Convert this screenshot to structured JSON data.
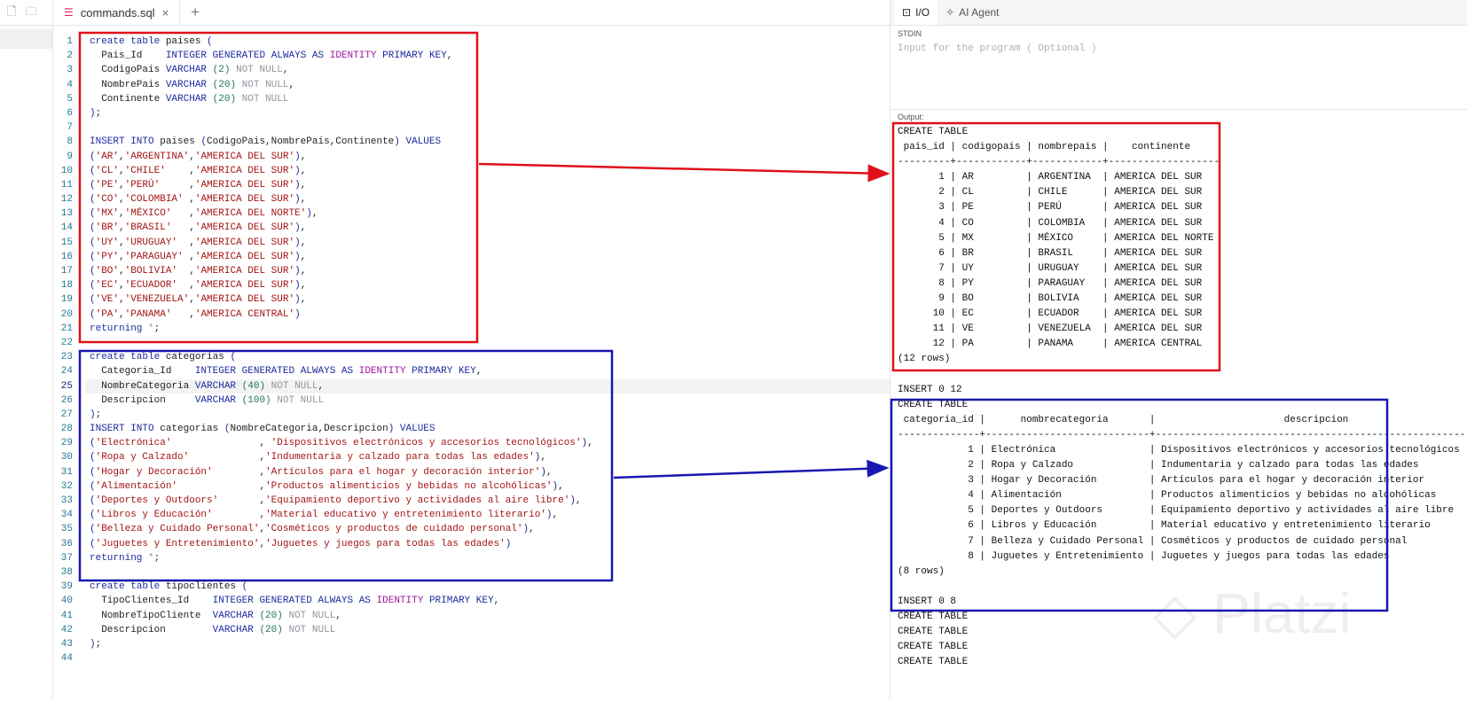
{
  "tab": {
    "filename": "commands.sql",
    "close": "×",
    "new_tab": "+"
  },
  "activity": {
    "new_file": "🗋",
    "new_folder": "🗀"
  },
  "right_tabs": [
    {
      "icon": "⊡",
      "label": "I/O"
    },
    {
      "icon": "✧",
      "label": "AI Agent"
    }
  ],
  "stdin": {
    "label": "STDIN",
    "placeholder": "Input for the program ( Optional )"
  },
  "output_label": "Output:",
  "current_line": 25,
  "colors": {
    "red_box": "#e0101a",
    "blue_box": "#1818b0",
    "keyword": "#1d2b9e",
    "string": "#a31515"
  },
  "code_lines": [
    "create table paises (",
    "  Pais_Id    INTEGER GENERATED ALWAYS AS IDENTITY PRIMARY KEY,",
    "  CodigoPais VARCHAR (2) NOT NULL,",
    "  NombrePais VARCHAR (20) NOT NULL,",
    "  Continente VARCHAR (20) NOT NULL",
    ");",
    "",
    "INSERT INTO paises (CodigoPais,NombrePais,Continente) VALUES",
    "('AR','ARGENTINA','AMERICA DEL SUR'),",
    "('CL','CHILE'    ,'AMERICA DEL SUR'),",
    "('PE','PERÚ'     ,'AMERICA DEL SUR'),",
    "('CO','COLOMBIA' ,'AMERICA DEL SUR'),",
    "('MX','MÉXICO'   ,'AMERICA DEL NORTE'),",
    "('BR','BRASIL'   ,'AMERICA DEL SUR'),",
    "('UY','URUGUAY'  ,'AMERICA DEL SUR'),",
    "('PY','PARAGUAY' ,'AMERICA DEL SUR'),",
    "('BO','BOLIVIA'  ,'AMERICA DEL SUR'),",
    "('EC','ECUADOR'  ,'AMERICA DEL SUR'),",
    "('VE','VENEZUELA','AMERICA DEL SUR'),",
    "('PA','PANAMA'   ,'AMERICA CENTRAL')",
    "returning *;",
    "",
    "create table categorias (",
    "  Categoria_Id    INTEGER GENERATED ALWAYS AS IDENTITY PRIMARY KEY,",
    "  NombreCategoria VARCHAR (40) NOT NULL,",
    "  Descripcion     VARCHAR (100) NOT NULL",
    ");",
    "INSERT INTO categorias (NombreCategoria,Descripcion) VALUES",
    "('Electrónica'               , 'Dispositivos electrónicos y accesorios tecnológicos'),",
    "('Ropa y Calzado'            ,'Indumentaria y calzado para todas las edades'),",
    "('Hogar y Decoración'        ,'Artículos para el hogar y decoración interior'),",
    "('Alimentación'              ,'Productos alimenticios y bebidas no alcohólicas'),",
    "('Deportes y Outdoors'       ,'Equipamiento deportivo y actividades al aire libre'),",
    "('Libros y Educación'        ,'Material educativo y entretenimiento literario'),",
    "('Belleza y Cuidado Personal','Cosméticos y productos de cuidado personal'),",
    "('Juguetes y Entretenimiento','Juguetes y juegos para todas las edades')",
    "returning *;",
    "",
    "create table tipoclientes (",
    "  TipoClientes_Id    INTEGER GENERATED ALWAYS AS IDENTITY PRIMARY KEY,",
    "  NombreTipoCliente  VARCHAR (20) NOT NULL,",
    "  Descripcion        VARCHAR (20) NOT NULL",
    ");",
    ""
  ],
  "output_lines": [
    "CREATE TABLE",
    " pais_id | codigopais | nombrepais |    continente",
    "---------+------------+------------+-------------------",
    "       1 | AR         | ARGENTINA  | AMERICA DEL SUR",
    "       2 | CL         | CHILE      | AMERICA DEL SUR",
    "       3 | PE         | PERÚ       | AMERICA DEL SUR",
    "       4 | CO         | COLOMBIA   | AMERICA DEL SUR",
    "       5 | MX         | MÉXICO     | AMERICA DEL NORTE",
    "       6 | BR         | BRASIL     | AMERICA DEL SUR",
    "       7 | UY         | URUGUAY    | AMERICA DEL SUR",
    "       8 | PY         | PARAGUAY   | AMERICA DEL SUR",
    "       9 | BO         | BOLIVIA    | AMERICA DEL SUR",
    "      10 | EC         | ECUADOR    | AMERICA DEL SUR",
    "      11 | VE         | VENEZUELA  | AMERICA DEL SUR",
    "      12 | PA         | PANAMA     | AMERICA CENTRAL",
    "(12 rows)",
    "",
    "INSERT 0 12",
    "CREATE TABLE",
    " categoria_id |      nombrecategoria       |                      descripcion",
    "--------------+----------------------------+-------------------------------------------------------",
    "            1 | Electrónica                | Dispositivos electrónicos y accesorios tecnológicos",
    "            2 | Ropa y Calzado             | Indumentaria y calzado para todas las edades",
    "            3 | Hogar y Decoración         | Artículos para el hogar y decoración interior",
    "            4 | Alimentación               | Productos alimenticios y bebidas no alcohólicas",
    "            5 | Deportes y Outdoors        | Equipamiento deportivo y actividades al aire libre",
    "            6 | Libros y Educación         | Material educativo y entretenimiento literario",
    "            7 | Belleza y Cuidado Personal | Cosméticos y productos de cuidado personal",
    "            8 | Juguetes y Entretenimiento | Juguetes y juegos para todas las edades",
    "(8 rows)",
    "",
    "INSERT 0 8",
    "CREATE TABLE",
    "CREATE TABLE",
    "CREATE TABLE",
    "CREATE TABLE"
  ],
  "watermark": "Platzi"
}
